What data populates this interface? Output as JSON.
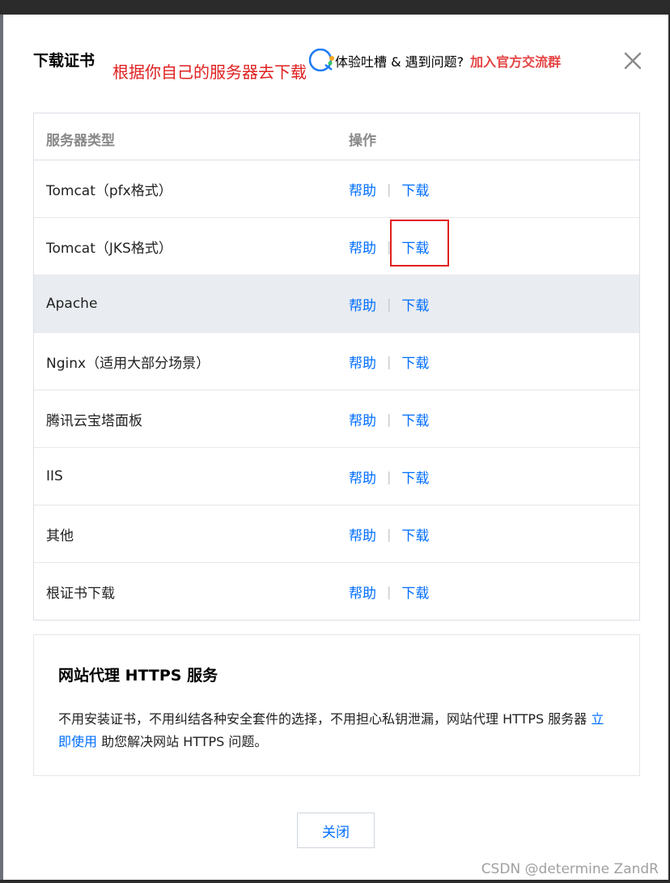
{
  "dialog": {
    "title": "下载证书",
    "annotation": "根据你自己的服务器去下载",
    "feedback_text": "体验吐槽 & 遇到问题?",
    "join_link": "加入官方交流群"
  },
  "table": {
    "headers": {
      "type": "服务器类型",
      "ops": "操作"
    },
    "rows": [
      {
        "name": "Tomcat（pfx格式）",
        "help": "帮助",
        "sep": "|",
        "download": "下载"
      },
      {
        "name": "Tomcat（JKS格式）",
        "help": "帮助",
        "sep": "|",
        "download": "下载"
      },
      {
        "name": "Apache",
        "help": "帮助",
        "sep": "|",
        "download": "下载"
      },
      {
        "name": "Nginx（适用大部分场景）",
        "help": "帮助",
        "sep": "|",
        "download": "下载"
      },
      {
        "name": "腾讯云宝塔面板",
        "help": "帮助",
        "sep": "|",
        "download": "下载"
      },
      {
        "name": "IIS",
        "help": "帮助",
        "sep": "|",
        "download": "下载"
      },
      {
        "name": "其他",
        "help": "帮助",
        "sep": "|",
        "download": "下载"
      },
      {
        "name": "根证书下载",
        "help": "帮助",
        "sep": "|",
        "download": "下载"
      }
    ]
  },
  "promo": {
    "title": "网站代理 HTTPS 服务",
    "desc_part1": "不用安装证书，不用纠结各种安全套件的选择，不用担心私钥泄漏，网站代理 HTTPS 服务器 ",
    "link": "立即使用",
    "desc_part2": " 助您解决网站 HTTPS 问题。"
  },
  "footer": {
    "close_label": "关闭"
  },
  "watermark": "CSDN @determine  ZandR",
  "colors": {
    "link": "#006eff",
    "annotation": "#e02020",
    "join": "#e54545",
    "hover_row": "#e9ecf1"
  },
  "icons": {
    "feedback": "feedback-bubble-icon",
    "close": "close-icon"
  }
}
